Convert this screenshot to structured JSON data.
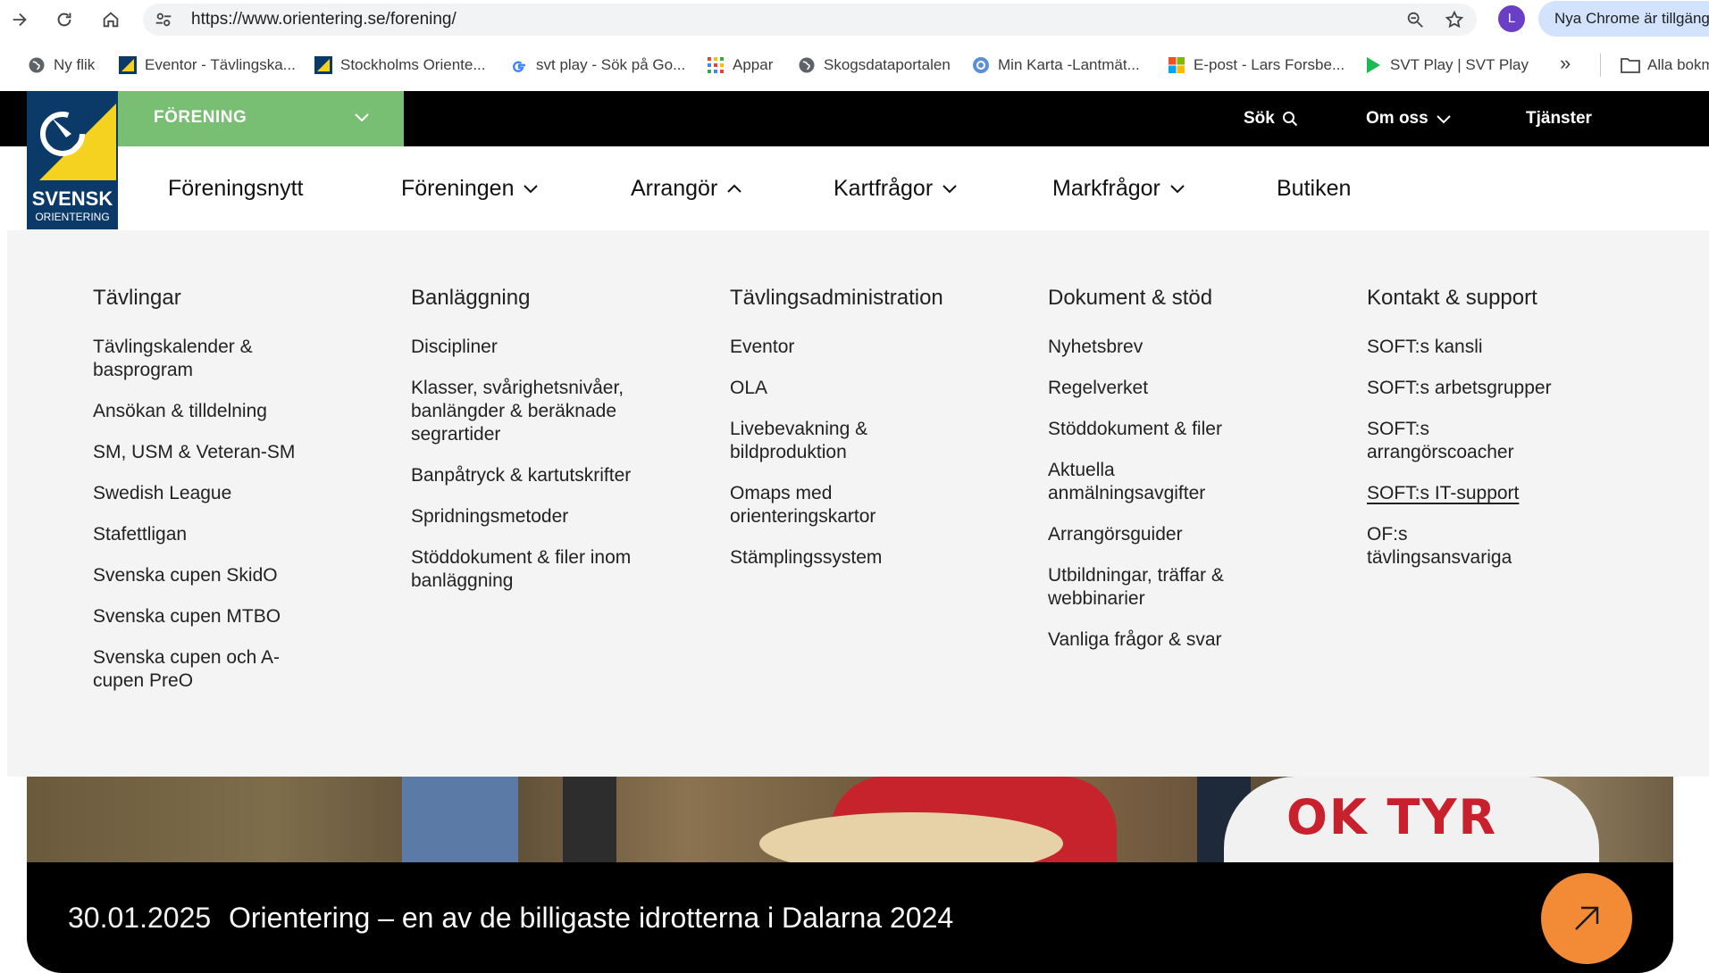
{
  "browser": {
    "url": "https://www.orientering.se/forening/",
    "profile_initial": "L",
    "update_label": "Nya Chrome är tillgängl",
    "bookmarks": [
      {
        "label": "Ny flik",
        "icon": "globe-icon"
      },
      {
        "label": "Eventor - Tävlingska...",
        "icon": "orienteering-icon"
      },
      {
        "label": "Stockholms Oriente...",
        "icon": "orienteering-icon"
      },
      {
        "label": "svt play - Sök på Go...",
        "icon": "google-icon"
      },
      {
        "label": "Appar",
        "icon": "apps-grid-icon"
      },
      {
        "label": "Skogsdataportalen",
        "icon": "globe-icon"
      },
      {
        "label": "Min Karta -Lantmät...",
        "icon": "map-pin-icon"
      },
      {
        "label": "E-post - Lars Forsbe...",
        "icon": "microsoft-icon"
      },
      {
        "label": "SVT Play | SVT Play",
        "icon": "play-icon"
      }
    ],
    "more_label": "»",
    "all_bookmarks_label": "Alla bokm"
  },
  "site": {
    "logo": {
      "word1": "SVENSK",
      "word2": "ORIENTERING"
    },
    "section_dropdown": "FÖRENING",
    "top_links": {
      "search": "Sök",
      "about": "Om oss",
      "services": "Tjänster"
    },
    "main_nav": [
      "Föreningsnytt",
      "Föreningen",
      "Arrangör",
      "Kartfrågor",
      "Markfrågor",
      "Butiken"
    ]
  },
  "mega_menu": {
    "columns": [
      {
        "heading": "Tävlingar",
        "items": [
          "Tävlingskalender & basprogram",
          "Ansökan & tilldelning",
          "SM, USM & Veteran-SM",
          "Swedish League",
          "Stafettligan",
          "Svenska cupen SkidO",
          "Svenska cupen MTBO",
          "Svenska cupen och A-cupen PreO"
        ]
      },
      {
        "heading": "Banläggning",
        "items": [
          "Discipliner",
          "Klasser, svårighetsnivåer, banlängder & beräknade segrartider",
          "Banpåtryck & kartutskrifter",
          "Spridningsmetoder",
          "Stöddokument & filer inom banläggning"
        ]
      },
      {
        "heading": "Tävlingsadministration",
        "items": [
          "Eventor",
          "OLA",
          "Livebevakning & bildproduktion",
          "Omaps med orienteringskartor",
          "Stämplingssystem"
        ]
      },
      {
        "heading": "Dokument & stöd",
        "items": [
          "Nyhetsbrev",
          "Regelverket",
          "Stöddokument & filer",
          "Aktuella anmälningsavgifter",
          "Arrangörsguider",
          "Utbildningar, träffar & webbinarier",
          "Vanliga frågor & svar"
        ]
      },
      {
        "heading": "Kontakt & support",
        "items": [
          "SOFT:s kansli",
          "SOFT:s arbetsgrupper",
          "SOFT:s arrangörscoacher",
          "SOFT:s IT-support",
          "OF:s tävlingsansvariga"
        ]
      }
    ]
  },
  "hero": {
    "shirt_text": "OK TYR",
    "date": "30.01.2025",
    "title": "Orientering – en av de billigaste idrotterna i Dalarna 2024"
  },
  "colors": {
    "brand_green": "#78be73",
    "brand_navy": "#0b3a68",
    "brand_yellow": "#f4d21f",
    "accent_orange": "#f28a36"
  }
}
